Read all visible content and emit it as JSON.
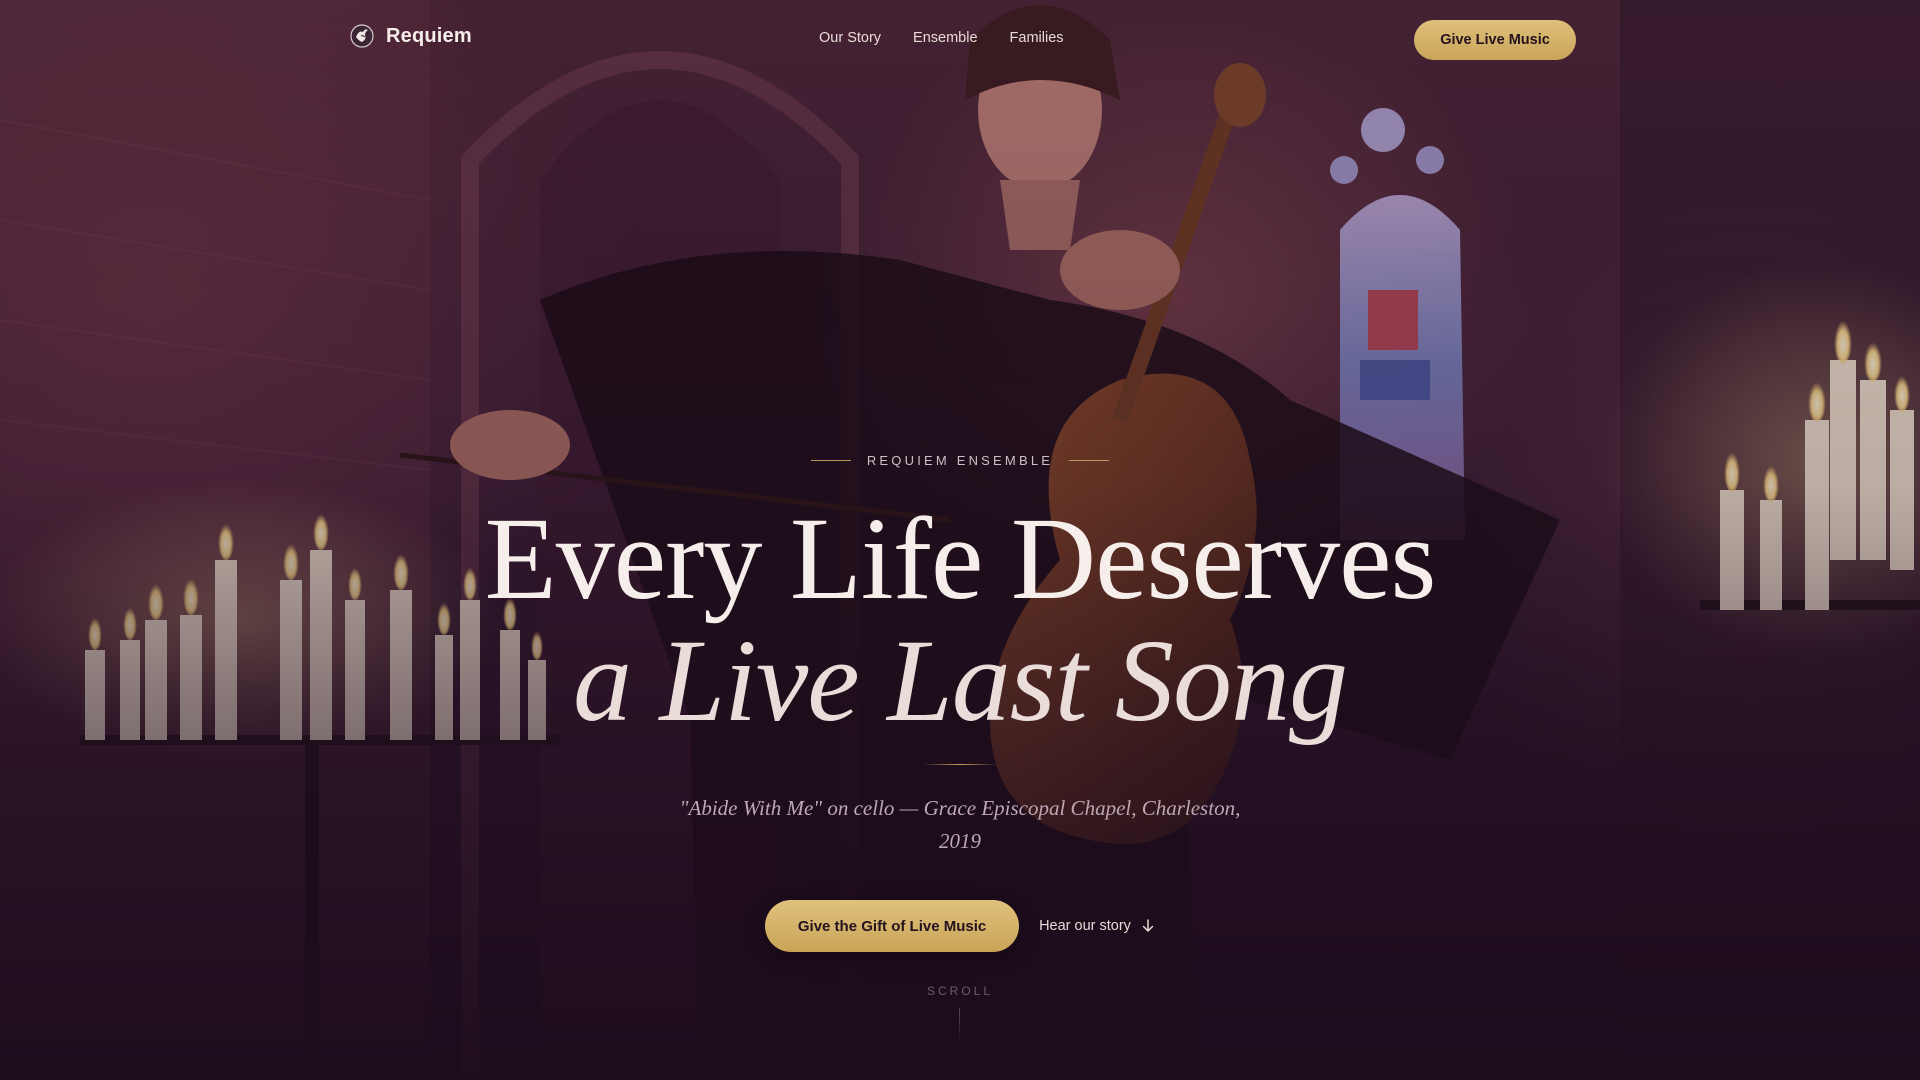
{
  "brand": {
    "name": "Requiem",
    "logo_icon": "dove-icon"
  },
  "nav": {
    "items": [
      {
        "label": "Our Story"
      },
      {
        "label": "Ensemble"
      },
      {
        "label": "Families"
      }
    ],
    "cta_label": "Give Live Music"
  },
  "hero": {
    "eyebrow": "REQUIEM ENSEMBLE",
    "title_line1": "Every Life Deserves",
    "title_line2": "a Live Last Song",
    "caption": "\"Abide With Me\" on cello — Grace Episcopal Chapel, Charleston, 2019",
    "primary_cta": "Give the Gift of Live Music",
    "secondary_cta": "Hear our story",
    "secondary_icon": "arrow-down-icon",
    "scroll_label": "SCROLL"
  },
  "colors": {
    "accent_gold": "#d6b46a",
    "background_plum": "#241225",
    "text_light": "#f6eeea"
  }
}
